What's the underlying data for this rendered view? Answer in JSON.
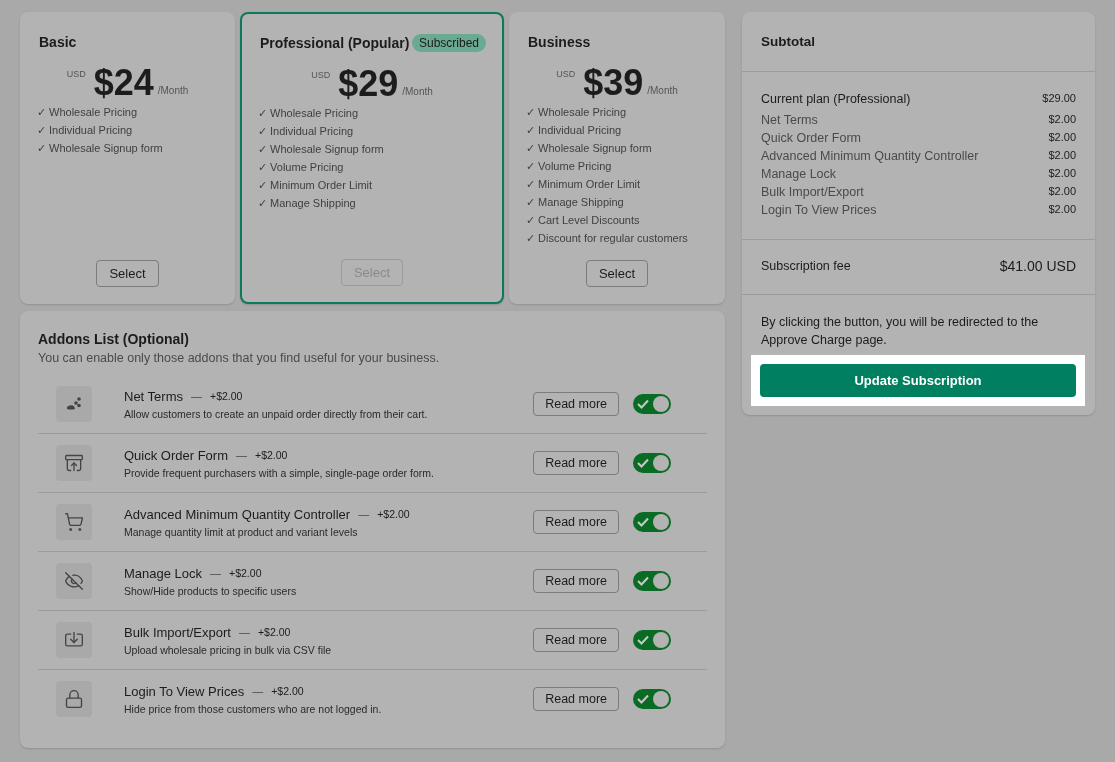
{
  "plans": [
    {
      "name": "Basic",
      "selected": false,
      "currency": "USD",
      "price": "$24",
      "period": "/Month",
      "features": [
        "✓ Wholesale Pricing",
        "✓ Individual Pricing",
        "✓ Wholesale Signup form"
      ],
      "button": "Select",
      "disabled": false
    },
    {
      "name": "Professional (Popular)",
      "selected": true,
      "badge": "Subscribed",
      "currency": "USD",
      "price": "$29",
      "period": "/Month",
      "features": [
        "✓ Wholesale Pricing",
        "✓ Individual Pricing",
        "✓ Wholesale Signup form",
        "✓ Volume Pricing",
        "✓ Minimum Order Limit",
        "✓ Manage Shipping"
      ],
      "button": "Select",
      "disabled": true
    },
    {
      "name": "Business",
      "selected": false,
      "currency": "USD",
      "price": "$39",
      "period": "/Month",
      "features": [
        "✓ Wholesale Pricing",
        "✓ Individual Pricing",
        "✓ Wholesale Signup form",
        "✓ Volume Pricing",
        "✓ Minimum Order Limit",
        "✓ Manage Shipping",
        "✓ Cart Level Discounts",
        "✓ Discount for regular customers"
      ],
      "button": "Select",
      "disabled": false
    }
  ],
  "addons": {
    "title": "Addons List (Optional)",
    "subtitle": "You can enable only those addons that you find useful for your business.",
    "items": [
      {
        "name": "Net Terms",
        "separator": "—",
        "price": "+$2.00",
        "description": "Allow customers to create an unpaid order directly from their cart.",
        "button": "Read more",
        "on": true
      },
      {
        "name": "Quick Order Form",
        "separator": "—",
        "price": "+$2.00",
        "description": "Provide frequent purchasers with a simple, single-page order form.",
        "button": "Read more",
        "on": true
      },
      {
        "name": "Advanced Minimum Quantity Controller",
        "separator": "—",
        "price": "+$2.00",
        "description": "Manage quantity limit at product and variant levels",
        "button": "Read more",
        "on": true
      },
      {
        "name": "Manage Lock",
        "separator": "—",
        "price": "+$2.00",
        "description": "Show/Hide products to specific users",
        "button": "Read more",
        "on": true
      },
      {
        "name": "Bulk Import/Export",
        "separator": "—",
        "price": "+$2.00",
        "description": "Upload wholesale pricing in bulk via CSV file",
        "button": "Read more",
        "on": true
      },
      {
        "name": "Login To View Prices",
        "separator": "—",
        "price": "+$2.00",
        "description": "Hide price from those customers who are not logged in.",
        "button": "Read more",
        "on": true
      }
    ]
  },
  "subtotal": {
    "title": "Subtotal",
    "plan": {
      "label": "Current plan (Professional)",
      "amount": "$29.00"
    },
    "lines": [
      {
        "label": "Net Terms",
        "amount": "$2.00"
      },
      {
        "label": "Quick Order Form",
        "amount": "$2.00"
      },
      {
        "label": "Advanced Minimum Quantity Controller",
        "amount": "$2.00"
      },
      {
        "label": "Manage Lock",
        "amount": "$2.00"
      },
      {
        "label": "Bulk Import/Export",
        "amount": "$2.00"
      },
      {
        "label": "Login To View Prices",
        "amount": "$2.00"
      }
    ],
    "fee": {
      "label": "Subscription fee",
      "amount": "$41.00 USD"
    },
    "note": "By clicking the button, you will be redirected to the Approve Charge page.",
    "button": "Update Subscription"
  }
}
